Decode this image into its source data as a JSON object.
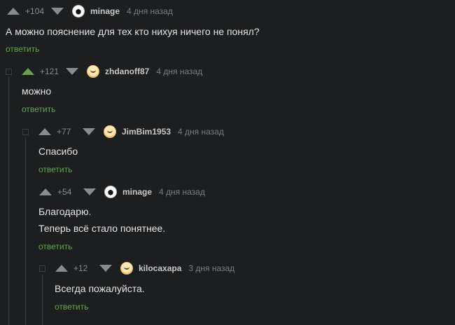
{
  "comments": [
    {
      "rating": "+104",
      "user": "minage",
      "time": "4 дня назад",
      "lines": [
        "А можно пояснение для тех кто нихуя ничего не понял?"
      ],
      "reply": "ответить"
    },
    {
      "rating": "+121",
      "user": "zhdanoff87",
      "time": "4 дня назад",
      "lines": [
        "можно"
      ],
      "reply": "ответить"
    },
    {
      "rating": "+77",
      "user": "JimBim1953",
      "time": "4 дня назад",
      "lines": [
        "Спасибо"
      ],
      "reply": "ответить"
    },
    {
      "rating": "+54",
      "user": "minage",
      "time": "4 дня назад",
      "lines": [
        "Благодарю.",
        "Теперь всё стало понятнее."
      ],
      "reply": "ответить"
    },
    {
      "rating": "+12",
      "user": "kilocaxapa",
      "time": "3 дня назад",
      "lines": [
        "Всегда пожалуйста."
      ],
      "reply": "ответить"
    }
  ],
  "colors": {
    "accent": "#67a34e",
    "background": "#1d1e20",
    "muted": "#8a8b8d"
  },
  "icons": [
    "collapse-icon",
    "upvote-icon",
    "downvote-icon",
    "avatar"
  ]
}
